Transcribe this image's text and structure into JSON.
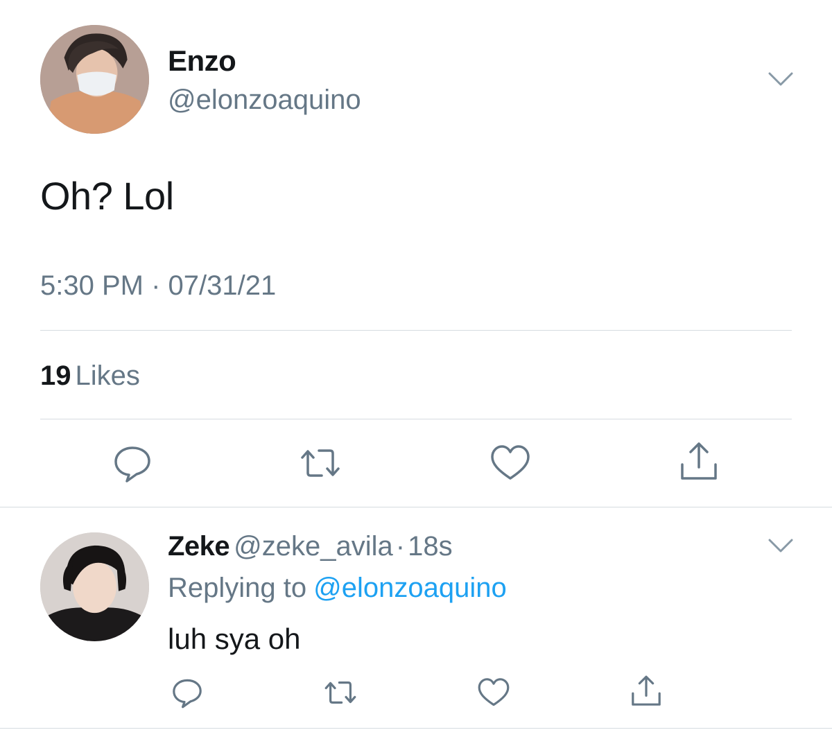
{
  "main_tweet": {
    "author_name": "Enzo",
    "author_handle": "@elonzoaquino",
    "text": "Oh? Lol",
    "timestamp": "5:30 PM · 07/31/21",
    "likes_count": "19",
    "likes_label": "Likes",
    "avatar_icon": "profile-photo",
    "menu_icon": "chevron-down-icon",
    "actions": [
      "reply-icon",
      "retweet-icon",
      "like-icon",
      "share-icon"
    ]
  },
  "reply_tweet": {
    "author_name": "Zeke",
    "author_handle": "@zeke_avila",
    "separator": "·",
    "relative_time": "18s",
    "replying_label": "Replying to",
    "replying_handle": "@elonzoaquino",
    "text": "luh sya oh",
    "avatar_icon": "profile-photo",
    "menu_icon": "chevron-down-icon",
    "actions": [
      "reply-icon",
      "retweet-icon",
      "like-icon",
      "share-icon"
    ]
  },
  "colors": {
    "text_primary": "#14171a",
    "text_secondary": "#657786",
    "link": "#1da1f2",
    "divider": "#d5dbe0",
    "icon": "#657786"
  }
}
